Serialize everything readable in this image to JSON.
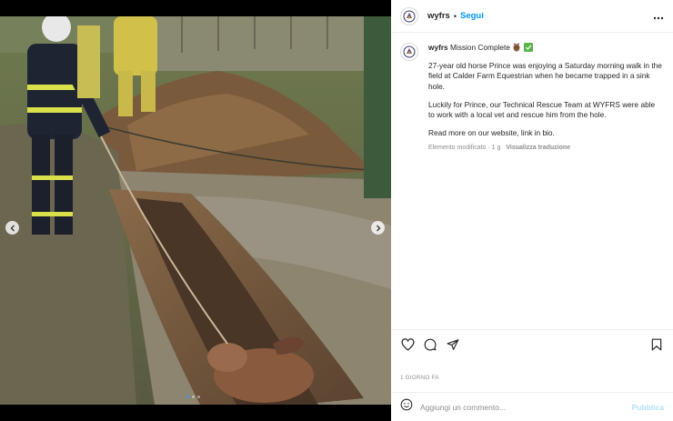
{
  "account": {
    "username": "wyfrs",
    "separator": "•",
    "follow_label": "Segui",
    "more_icon": "more-options-icon",
    "avatar_icon": "fire-service-crest-icon"
  },
  "post": {
    "caption_title": "Mission Complete",
    "title_emojis": [
      "horse-face-emoji",
      "check-mark-emoji"
    ],
    "paragraph_1": "27-year old horse Prince was enjoying a Saturday morning walk in the field at Calder Farm Equestrian when he became trapped in a sink hole.",
    "paragraph_2": "Luckily for Prince, our Technical Rescue Team at WYFRS were able to work with a local vet and rescue him from the hole.",
    "paragraph_3": "Read more on our website, link in bio.",
    "edited_label": "Elemento modificato",
    "meta_separator": "·",
    "age_short": "1 g",
    "translate_label": "Visualizza traduzione"
  },
  "media": {
    "description_icon": "rescue-photo",
    "prev_icon": "chevron-left-icon",
    "next_icon": "chevron-right-icon",
    "slides_total": 3,
    "active_slide": 1
  },
  "actions": {
    "like_icon": "heart-icon",
    "comment_icon": "comment-icon",
    "share_icon": "share-icon",
    "save_icon": "bookmark-icon"
  },
  "time_ago": "1 GIORNO FA",
  "comment": {
    "emoji_icon": "smiley-icon",
    "placeholder": "Aggiungi un commento...",
    "publish_label": "Pubblica"
  },
  "colors": {
    "accent": "#0095f6",
    "publish_disabled": "#b2dffc",
    "muted_text": "#8e8e8e",
    "border": "#efefef"
  }
}
